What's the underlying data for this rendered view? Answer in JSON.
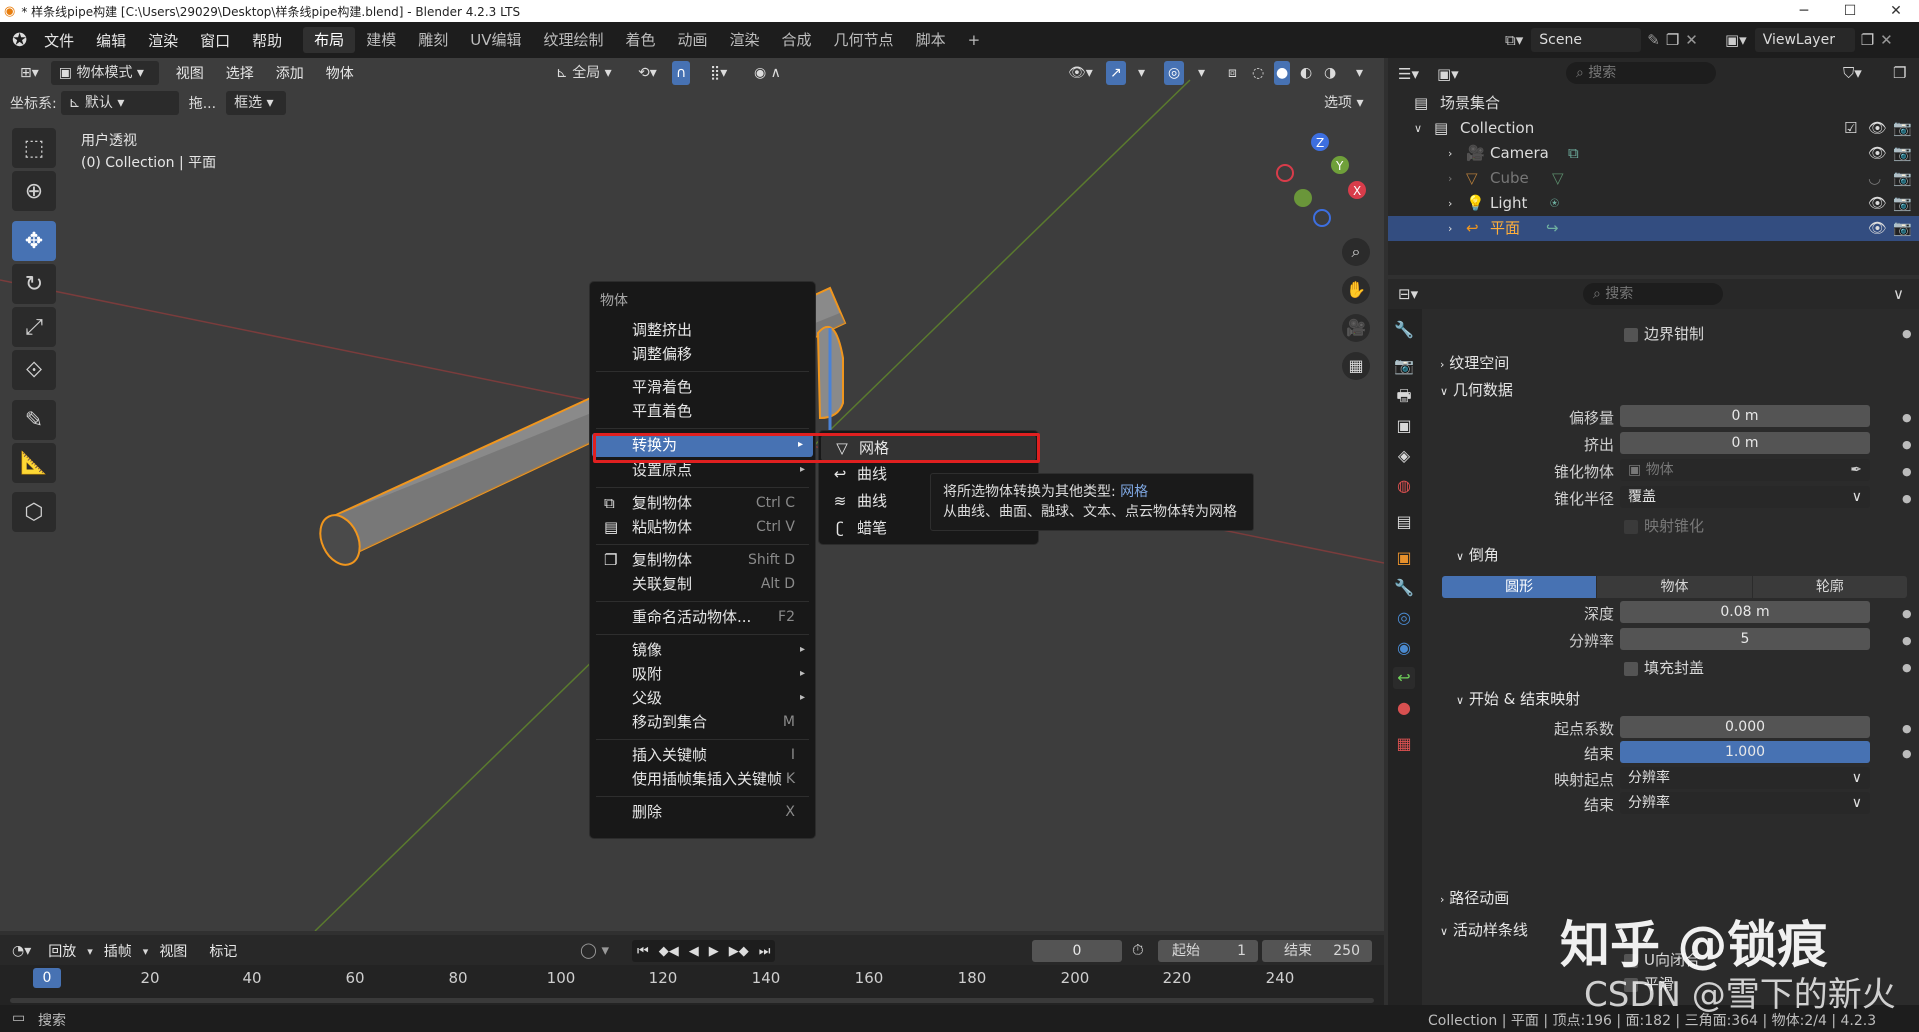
{
  "window": {
    "title": "* 样条线pipe构建 [C:\\Users\\29029\\Desktop\\样条线pipe构建.blend] - Blender 4.2.3 LTS",
    "controls": [
      "─",
      "☐",
      "✕"
    ]
  },
  "menubar": {
    "items": [
      "文件",
      "编辑",
      "渲染",
      "窗口",
      "帮助"
    ],
    "workspaces": [
      "布局",
      "建模",
      "雕刻",
      "UV编辑",
      "纹理绘制",
      "着色",
      "动画",
      "渲染",
      "合成",
      "几何节点",
      "脚本",
      "+"
    ],
    "active_workspace": "布局",
    "scene": "Scene",
    "view_layer": "ViewLayer"
  },
  "viewport": {
    "mode": "物体模式",
    "menus": [
      "视图",
      "选择",
      "添加",
      "物体"
    ],
    "transform_orientation": "全局",
    "coord_label": "坐标系:",
    "coord_value": "默认",
    "drag_label": "拖...",
    "select_mode": "框选",
    "options": "选项",
    "view_name": "用户透视",
    "view_sub": "(0) Collection | 平面"
  },
  "context_menu": {
    "title": "物体",
    "items": [
      {
        "label": "调整挤出",
        "shortcut": ""
      },
      {
        "label": "调整偏移",
        "shortcut": ""
      },
      {
        "label": "平滑着色",
        "shortcut": ""
      },
      {
        "label": "平直着色",
        "shortcut": ""
      },
      {
        "label": "转换为",
        "shortcut": "▸"
      },
      {
        "label": "设置原点",
        "shortcut": "▸"
      },
      {
        "label": "复制物体",
        "shortcut": "Ctrl C"
      },
      {
        "label": "粘贴物体",
        "shortcut": "Ctrl V"
      },
      {
        "label": "复制物体",
        "shortcut": "Shift D"
      },
      {
        "label": "关联复制",
        "shortcut": "Alt D"
      },
      {
        "label": "重命名活动物体...",
        "shortcut": "F2"
      },
      {
        "label": "镜像",
        "shortcut": "▸"
      },
      {
        "label": "吸附",
        "shortcut": "▸"
      },
      {
        "label": "父级",
        "shortcut": "▸"
      },
      {
        "label": "移动到集合",
        "shortcut": "M"
      },
      {
        "label": "插入关键帧",
        "shortcut": "I"
      },
      {
        "label": "使用插帧集插入关键帧",
        "shortcut": "K"
      },
      {
        "label": "删除",
        "shortcut": "X"
      }
    ]
  },
  "submenu": {
    "items": [
      "网格",
      "曲线",
      "曲线",
      "蜡笔"
    ]
  },
  "tooltip": {
    "line1_prefix": "将所选物体转换为其他类型: ",
    "line1_link": "网格",
    "line2": "从曲线、曲面、融球、文本、点云物体转为网格"
  },
  "outliner": {
    "search_placeholder": "搜索",
    "root": "场景集合",
    "collection": "Collection",
    "objects": [
      "Camera",
      "Cube",
      "Light",
      "平面"
    ],
    "selected": "平面"
  },
  "properties": {
    "search_placeholder": "搜索",
    "border_clamp": "边界钳制",
    "sections": {
      "texture_space": "纹理空间",
      "geometry": "几何数据",
      "bevel": "倒角",
      "start_end": "开始 & 结束映射",
      "path_anim": "路径动画",
      "active_spline": "活动样条线"
    },
    "offset_label": "偏移量",
    "offset_value": "0 m",
    "extrude_label": "挤出",
    "extrude_value": "0 m",
    "taper_obj_label": "锥化物体",
    "taper_obj_placeholder": "物体",
    "taper_radius_label": "锥化半径",
    "taper_radius_value": "覆盖",
    "map_taper": "映射锥化",
    "bevel_tabs": [
      "圆形",
      "物体",
      "轮廓"
    ],
    "bevel_active": "圆形",
    "depth_label": "深度",
    "depth_value": "0.08 m",
    "res_label": "分辨率",
    "res_value": "5",
    "fill_caps": "填充封盖",
    "start_factor_label": "起点系数",
    "start_factor_value": "0.000",
    "end_label": "结束",
    "end_value": "1.000",
    "map_start_label": "映射起点",
    "map_start_value": "分辨率",
    "map_end_label": "结束",
    "map_end_value": "分辨率",
    "cyclic": "U向闭合",
    "smooth": "平滑"
  },
  "timeline": {
    "menus": [
      "回放",
      "插帧",
      "视图",
      "标记"
    ],
    "current_frame": "0",
    "start_label": "起始",
    "start_value": "1",
    "end_label": "结束",
    "end_value": "250",
    "ticks": [
      "0",
      "20",
      "40",
      "60",
      "80",
      "100",
      "120",
      "140",
      "160",
      "180",
      "200",
      "220",
      "240"
    ]
  },
  "statusbar": {
    "search": "搜索",
    "info": "Collection | 平面 | 顶点:196 | 面:182 | 三角面:364 | 物体:2/4 | 4.2.3"
  },
  "watermark": {
    "line1": "知乎 @锁痕",
    "line2": "CSDN @雪下的新火"
  },
  "colors": {
    "accent": "#4772b3",
    "highlight_red": "#e02020",
    "selection_orange": "#e8912c"
  }
}
